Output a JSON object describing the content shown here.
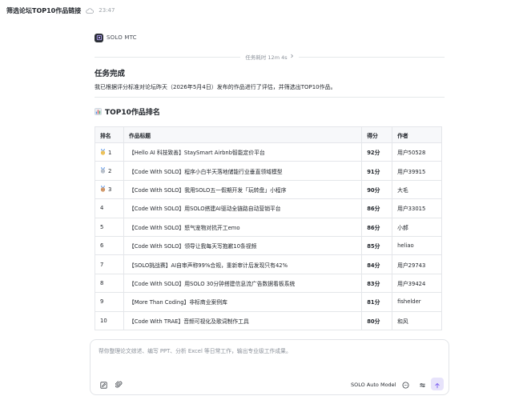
{
  "header": {
    "title": "筛选论坛TOP10作品链接",
    "time": "23:47"
  },
  "agent": {
    "name": "SOLO MTC"
  },
  "task_duration": "任务耗时 12m 4s",
  "task": {
    "title": "任务完成",
    "description": "我已根据评分标准对论坛昨天（2026年5月4日）发布的作品进行了评估，并筛选出TOP10作品。"
  },
  "section": {
    "icon": "bar-chart-icon",
    "title": "TOP10作品排名"
  },
  "table": {
    "headers": [
      "排名",
      "作品标题",
      "得分",
      "作者"
    ],
    "rows": [
      {
        "rank": "1",
        "medal": "gold",
        "title": "【Hello AI 科技致善】StaySmart Airbnb智能定价平台",
        "score": "92分",
        "author": "用户50528"
      },
      {
        "rank": "2",
        "medal": "silver",
        "title": "【Code With SOLO】程序小白半天落地储能行业垂直领域模型",
        "score": "91分",
        "author": "用户39915"
      },
      {
        "rank": "3",
        "medal": "bronze",
        "title": "【Code With SOLO】我用SOLO五一假期开发「玩转盘」小程序",
        "score": "90分",
        "author": "大毛"
      },
      {
        "rank": "4",
        "medal": "",
        "title": "【Code With SOLO】用SOLO搭建AI驱动全链路自动营销平台",
        "score": "86分",
        "author": "用户33015"
      },
      {
        "rank": "5",
        "medal": "",
        "title": "【Code With SOLO】怒气宠物对抗开工emo",
        "score": "86分",
        "author": "小郝"
      },
      {
        "rank": "6",
        "medal": "",
        "title": "【Code With SOLO】领导让我每天写抱歉10条视频",
        "score": "85分",
        "author": "heliao"
      },
      {
        "rank": "7",
        "medal": "",
        "title": "【SOLO挑战赛】AI自审声称99%合规，重新审计后发现只有42%",
        "score": "84分",
        "author": "用户29743"
      },
      {
        "rank": "8",
        "medal": "",
        "title": "【Code With SOLO】用SOLO 30分钟搭建信息流广告数据看板系统",
        "score": "83分",
        "author": "用户39424"
      },
      {
        "rank": "9",
        "medal": "",
        "title": "【More Than Coding】非标商业案例库",
        "score": "81分",
        "author": "fishelder"
      },
      {
        "rank": "10",
        "medal": "",
        "title": "【Code With TRAE】音频可视化及歌词制作工具",
        "score": "80分",
        "author": "和风"
      }
    ]
  },
  "composer": {
    "placeholder": "帮你整理论文综述、编写 PPT、分析 Excel 等日常工作，输出专业级工作成果。",
    "model": "SOLO Auto Model",
    "icons": [
      "edit-icon",
      "attach-icon",
      "chat-icon",
      "send-icon"
    ]
  },
  "colors": {
    "send_bg": "#e7e3fb",
    "send_arrow": "#7a5cf0",
    "gold": "#e8b53a",
    "silver": "#aab3bf",
    "bronze": "#c7824a"
  }
}
